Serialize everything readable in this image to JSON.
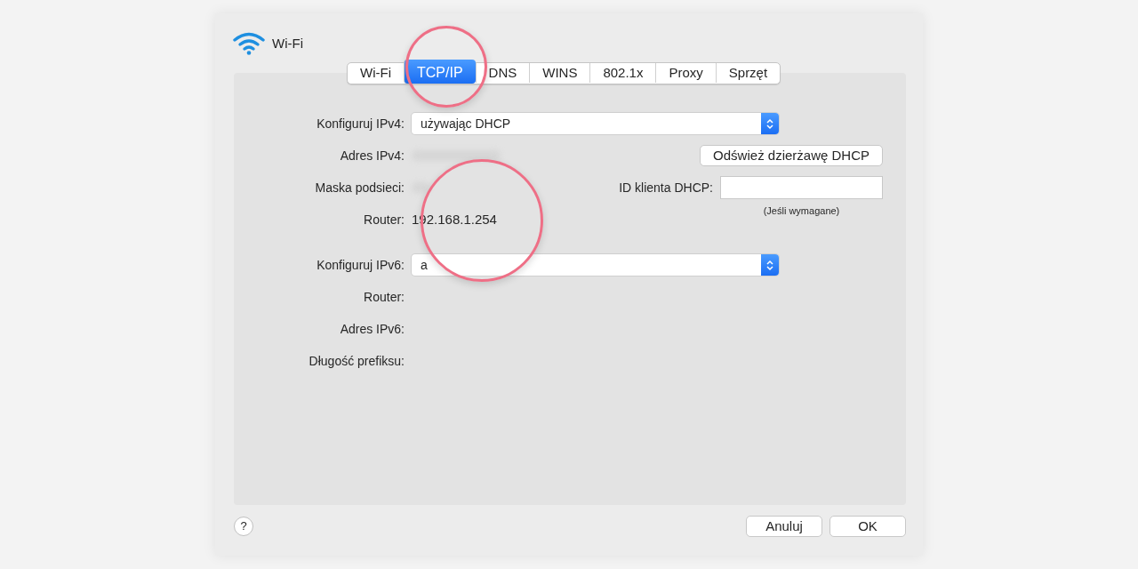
{
  "window": {
    "title": "Wi-Fi"
  },
  "tabs": [
    {
      "label": "Wi-Fi",
      "selected": false
    },
    {
      "label": "TCP/IP",
      "selected": true
    },
    {
      "label": "DNS",
      "selected": false
    },
    {
      "label": "WINS",
      "selected": false
    },
    {
      "label": "802.1x",
      "selected": false
    },
    {
      "label": "Proxy",
      "selected": false
    },
    {
      "label": "Sprzęt",
      "selected": false
    }
  ],
  "ipv4": {
    "configure_label": "Konfiguruj IPv4:",
    "configure_value": "używając DHCP",
    "address_label": "Adres IPv4:",
    "subnet_label": "Maska podsieci:",
    "router_label": "Router:",
    "router_value": "192.168.1.254"
  },
  "renew_button": "Odśwież dzierżawę DHCP",
  "dhcp_client_id": {
    "label": "ID klienta DHCP:",
    "hint": "(Jeśli wymagane)"
  },
  "ipv6": {
    "configure_label": "Konfiguruj IPv6:",
    "configure_value": "a",
    "router_label": "Router:",
    "address_label": "Adres IPv6:",
    "prefix_label": "Długość prefiksu:"
  },
  "help_button": "?",
  "buttons": [
    "Anuluj",
    "OK"
  ]
}
